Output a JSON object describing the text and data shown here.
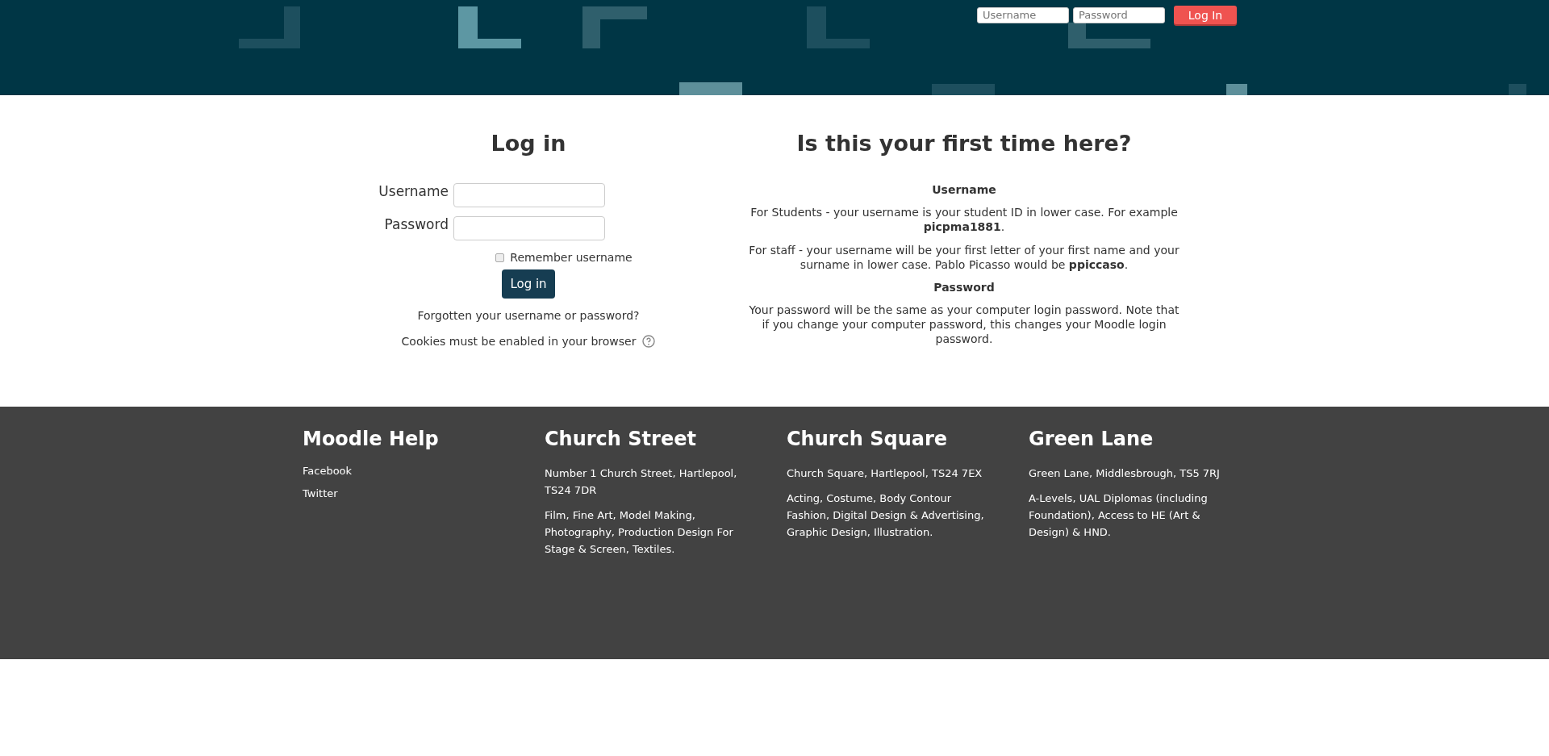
{
  "top_login": {
    "username_placeholder": "Username",
    "password_placeholder": "Password",
    "button": "Log In"
  },
  "login": {
    "title": "Log in",
    "username_label": "Username",
    "password_label": "Password",
    "remember": {
      "label": "Remember username",
      "checked": false
    },
    "button": "Log in",
    "forgot_link": "Forgotten your username or password?",
    "cookies_note": "Cookies must be enabled in your browser"
  },
  "first_time": {
    "title": "Is this your first time here?",
    "sections": [
      {
        "heading": "Username",
        "paragraphs": [
          "For Students - your username is your student ID in lower case. For example **picpma1881**.",
          "For staff - your username will be your first letter of your first name and your surname in lower case. Pablo Picasso would be **ppiccaso**."
        ]
      },
      {
        "heading": "Password",
        "paragraphs": [
          "Your password will be the same as your computer login password. Note that if you change your computer password, this changes your Moodle login password."
        ]
      }
    ]
  },
  "footer": {
    "columns": [
      {
        "title": "Moodle Help",
        "links": [
          "Facebook",
          "Twitter"
        ]
      },
      {
        "title": "Church Street",
        "paragraphs": [
          "Number 1 Church Street, Hartlepool, TS24 7DR",
          "Film, Fine Art, Model Making, Photography, Production Design For Stage & Screen, Textiles."
        ]
      },
      {
        "title": "Church Square",
        "paragraphs": [
          "Church Square, Hartlepool, TS24 7EX",
          "Acting, Costume, Body Contour Fashion, Digital Design & Advertising, Graphic Design, Illustration."
        ]
      },
      {
        "title": "Green Lane",
        "paragraphs": [
          "Green Lane, Middlesbrough, TS5 7RJ",
          "A-Levels, UAL Diplomas (including Foundation), Access to HE (Art & Design) & HND."
        ]
      }
    ]
  }
}
